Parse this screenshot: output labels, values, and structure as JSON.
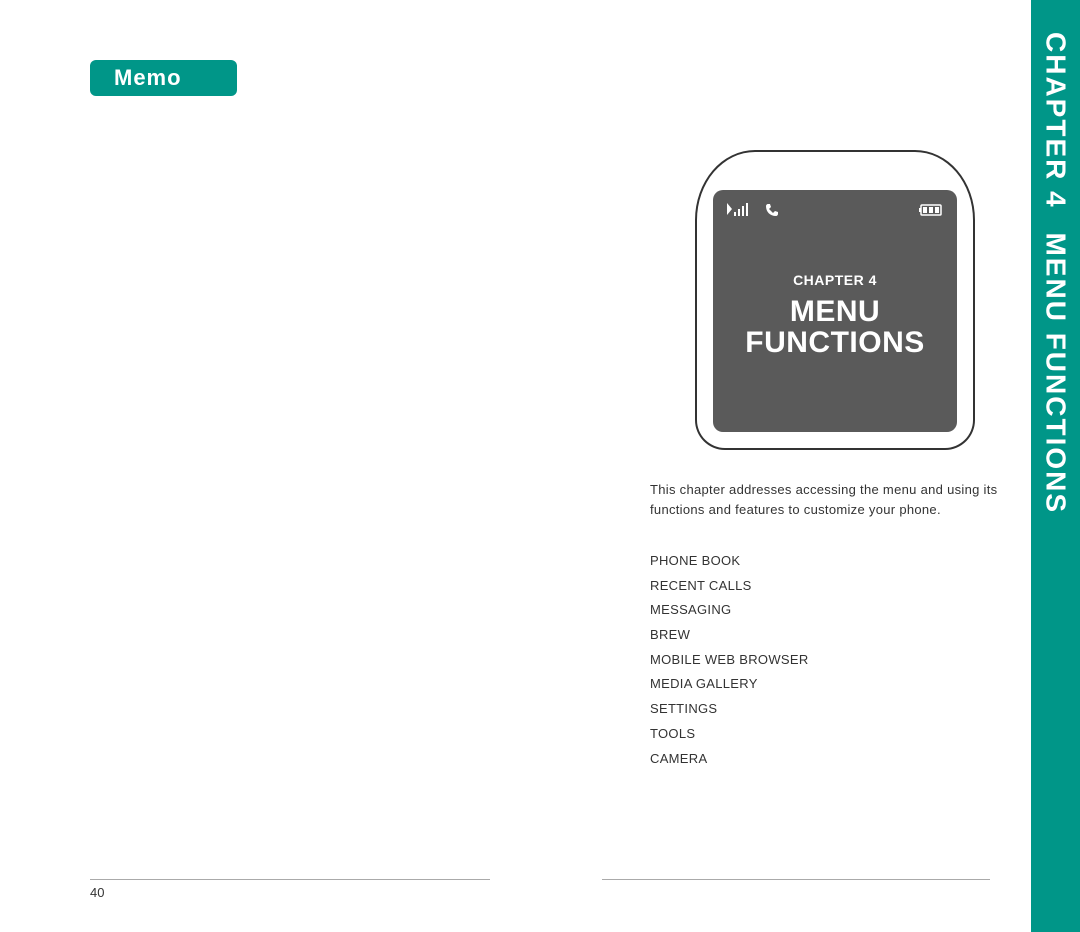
{
  "leftPage": {
    "header": "Memo",
    "pageNumber": "40"
  },
  "rightPage": {
    "phoneScreen": {
      "chapterLabel": "CHAPTER 4",
      "titleLine1": "MENU",
      "titleLine2": "FUNCTIONS"
    },
    "description": "This chapter addresses accessing the menu and using its functions and features to customize your phone.",
    "menuItems": [
      "PHONE BOOK",
      "RECENT CALLS",
      "MESSAGING",
      "BREW",
      "MOBILE WEB BROWSER",
      "MEDIA GALLERY",
      "SETTINGS",
      "TOOLS",
      "CAMERA"
    ],
    "sideTab": {
      "chapter": "CHAPTER 4",
      "title": "MENU FUNCTIONS"
    }
  }
}
